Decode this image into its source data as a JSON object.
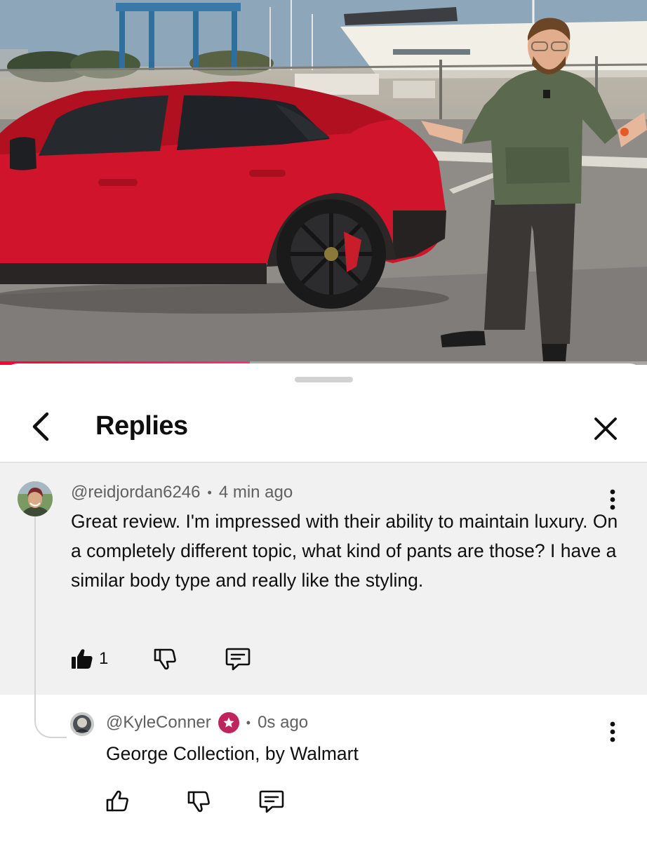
{
  "video": {
    "progress_fraction": 0.386
  },
  "sheet": {
    "title": "Replies"
  },
  "parent_comment": {
    "author": "@reidjordan6246",
    "time": "4 min ago",
    "text": "Great review. I'm impressed with their ability to maintain luxury. On a completely different topic, what kind of pants are those? I have a similar body type and really like the styling.",
    "like_count": "1",
    "like_state": "liked"
  },
  "reply": {
    "author": "@KyleConner",
    "time": "0s ago",
    "text": "George Collection, by Walmart",
    "creator_badge": "star-badge-icon"
  },
  "colors": {
    "progress_red": "#ff0033",
    "progress_pink": "#ff2d7a",
    "badge": "#c0245c",
    "parent_bg": "#f1f1f1",
    "car_red": "#d0142c"
  },
  "separator": "•"
}
